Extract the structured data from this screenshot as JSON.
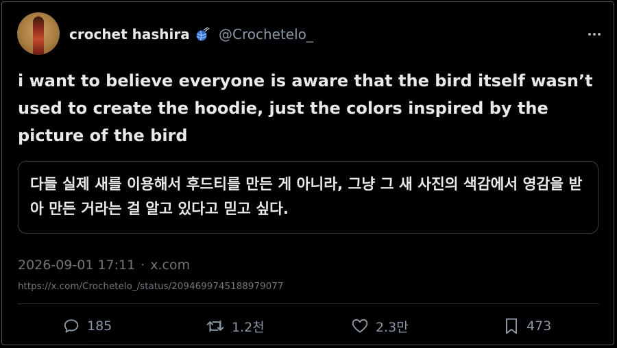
{
  "author": {
    "display_name": "crochet hashira",
    "badge_icon": "yarn-ball-icon",
    "handle": "@Crochetelo_"
  },
  "tweet": {
    "text": "i want to believe everyone is aware that the bird itself wasn’t used to create the hoodie, just the colors inspired by the picture of the bird",
    "translation": "다들 실제 새를 이용해서 후드티를 만든 게 아니라, 그냥 그 새 사진의 색감에서 영감을 받아 만든 거라는 걸 알고 있다고 믿고 싶다.",
    "timestamp": "2026-09-01 17:11",
    "source": "x.com",
    "url": "https://x.com/Crochetelo_/status/2094699745188979077"
  },
  "actions": {
    "replies": "185",
    "reposts": "1.2천",
    "likes": "2.3만",
    "bookmarks": "473"
  },
  "colors": {
    "background": "#000000",
    "text": "#e7e9ea",
    "muted": "#71767b",
    "badge": "#1d9bf0"
  }
}
